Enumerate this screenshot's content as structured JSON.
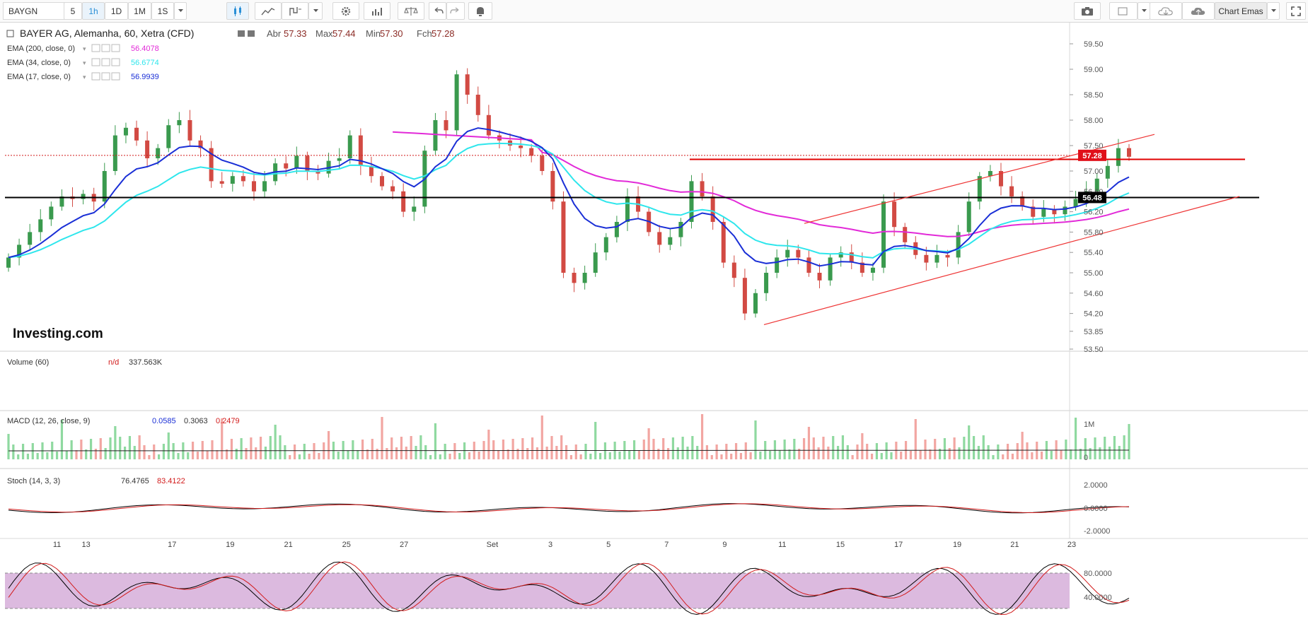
{
  "toolbar": {
    "symbol": "BAYGN",
    "intervals": [
      "5",
      "1h",
      "1D",
      "1M",
      "1S"
    ],
    "active_interval": "1h",
    "chart_name": "Chart Emas"
  },
  "chart_data": {
    "type": "candlestick",
    "title": "BAYER AG, Alemanha, 60, Xetra (CFD)",
    "ohlc_labels": {
      "open": "Abr",
      "high": "Max",
      "low": "Min",
      "close": "Fch"
    },
    "ohlc": {
      "open": "57.33",
      "high": "57.44",
      "low": "57.30",
      "close": "57.28"
    },
    "colors": {
      "up": "#3a9a4e",
      "down": "#d24a43",
      "ema200": "#e22ad8",
      "ema34": "#2ee6ec",
      "ema17": "#1a2fd6",
      "macd": "#000000",
      "signal": "#d21a1a"
    },
    "indicators": [
      {
        "label": "EMA (200, close, 0)",
        "value": "56.4078",
        "color": "#e22ad8"
      },
      {
        "label": "EMA (34, close, 0)",
        "value": "56.6774",
        "color": "#2ee6ec"
      },
      {
        "label": "EMA (17, close, 0)",
        "value": "56.9939",
        "color": "#1a2fd6"
      }
    ],
    "price_axis": {
      "ticks": [
        "59.50",
        "59.00",
        "58.50",
        "58.00",
        "57.50",
        "57.00",
        "56.60",
        "56.20",
        "55.80",
        "55.40",
        "55.00",
        "54.60",
        "54.20",
        "53.85",
        "53.50"
      ],
      "ylim": [
        53.5,
        59.6
      ]
    },
    "x_ticks": [
      "11",
      "13",
      "17",
      "19",
      "21",
      "25",
      "27",
      "Set",
      "3",
      "5",
      "7",
      "9",
      "11",
      "15",
      "17",
      "19",
      "21",
      "23"
    ],
    "current_price": "57.28",
    "support_level": "56.48",
    "closes": [
      55.3,
      55.55,
      55.8,
      56.05,
      56.3,
      56.5,
      56.45,
      56.55,
      56.4,
      57.0,
      57.7,
      57.85,
      57.6,
      57.25,
      57.45,
      57.9,
      58.0,
      57.6,
      57.45,
      56.8,
      56.75,
      56.9,
      56.8,
      56.6,
      56.8,
      57.15,
      57.05,
      57.3,
      57.0,
      56.95,
      57.2,
      57.25,
      57.7,
      57.1,
      56.9,
      56.7,
      56.6,
      56.2,
      56.3,
      57.4,
      58.0,
      57.8,
      58.9,
      58.5,
      58.1,
      57.7,
      57.6,
      57.5,
      57.45,
      57.3,
      57.0,
      56.4,
      55.0,
      54.8,
      55.0,
      55.4,
      55.7,
      56.0,
      56.5,
      56.2,
      55.8,
      55.55,
      55.7,
      56.0,
      56.8,
      56.5,
      56.0,
      55.2,
      54.9,
      54.2,
      54.6,
      55.0,
      55.3,
      55.45,
      55.3,
      55.0,
      54.85,
      55.3,
      55.4,
      55.2,
      55.0,
      55.1,
      56.4,
      55.9,
      55.6,
      55.35,
      55.2,
      55.35,
      55.3,
      55.8,
      56.4,
      56.9,
      57.0,
      56.7,
      56.5,
      56.3,
      56.1,
      56.25,
      56.15,
      56.3,
      56.45,
      56.6,
      56.85,
      57.1,
      57.45,
      57.28
    ],
    "volume": {
      "label": "Volume (60)",
      "na": "n/d",
      "value": "337.563K",
      "ticks": [
        "1M",
        "0"
      ]
    },
    "macd": {
      "label": "MACD (12, 26, close, 9)",
      "values": [
        "0.0585",
        "0.3063",
        "0.2479"
      ],
      "ticks": [
        "2.0000",
        "0.0000",
        "-2.0000"
      ]
    },
    "stoch": {
      "label": "Stoch (14, 3, 3)",
      "values": [
        "76.4765",
        "83.4122"
      ],
      "ticks": [
        "80.0000",
        "40.0000"
      ]
    }
  },
  "watermark": "Investing.com"
}
